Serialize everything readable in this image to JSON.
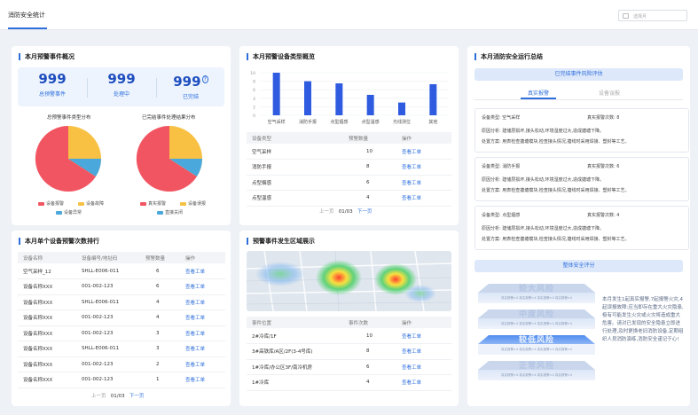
{
  "header": {
    "tab": "消防安全统计",
    "month_placeholder": "选择月"
  },
  "overview": {
    "title": "本月预警事件概况",
    "stats": [
      {
        "value": "999",
        "label": "总预警事件"
      },
      {
        "value": "999",
        "label": "处理中"
      },
      {
        "value": "999",
        "label": "已完结",
        "help": "?"
      }
    ],
    "pie1": {
      "title": "总预警事件类型分布"
    },
    "pie2": {
      "title": "已完结事件处理结果分布"
    },
    "legend1": [
      "设备报警",
      "设备故障",
      "设备异常"
    ],
    "legend2": [
      "真实报警",
      "设备误报",
      "直接关闭"
    ],
    "colors": {
      "red": "#f25562",
      "yellow": "#f8c144",
      "blue": "#4aa8dc"
    }
  },
  "chart_data": {
    "type": "bar",
    "title": "本月预警设备类型概览",
    "categories": [
      "空气采样",
      "消防手报",
      "点型烟感",
      "点型温感",
      "光线测位",
      "其他"
    ],
    "values": [
      10,
      8,
      7.5,
      4.8,
      3,
      7.3
    ],
    "ylim": [
      0,
      10
    ],
    "yticks": [
      "10",
      "8",
      "6",
      "4",
      "2",
      "0"
    ],
    "color": "#2e5be0"
  },
  "device_table": {
    "headers": [
      "设备类型",
      "预警数量",
      "操作"
    ],
    "rows": [
      [
        "空气采样",
        "10",
        "查看工单"
      ],
      [
        "消防手报",
        "8",
        "查看工单"
      ],
      [
        "点型烟感",
        "6",
        "查看工单"
      ],
      [
        "点型温感",
        "4",
        "查看工单"
      ]
    ],
    "pager": {
      "prev": "上一页",
      "page": "01/03",
      "next": "下一页"
    }
  },
  "ranking": {
    "title": "本月单个设备预警次数排行",
    "headers": [
      "设备名称",
      "设备编号/地址码",
      "预警数量",
      "操作"
    ],
    "rows": [
      [
        "空气采样_12",
        "SHLL-E006-011",
        "6",
        "查看工单"
      ],
      [
        "设备名称XXX",
        "001-002-123",
        "6",
        "查看工单"
      ],
      [
        "设备名称XXX",
        "SHLL-E006-011",
        "4",
        "查看工单"
      ],
      [
        "设备名称XXX",
        "001-002-123",
        "4",
        "查看工单"
      ],
      [
        "设备名称XXX",
        "001-002-123",
        "3",
        "查看工单"
      ],
      [
        "设备名称XXX",
        "SHLL-E006-011",
        "3",
        "查看工单"
      ],
      [
        "设备名称XXX",
        "001-002-123",
        "2",
        "查看工单"
      ],
      [
        "设备名称XXX",
        "001-002-123",
        "1",
        "查看工单"
      ]
    ],
    "pager": {
      "prev": "上一页",
      "page": "01/03",
      "next": "下一页"
    }
  },
  "area": {
    "title": "预警事件发生区域展示",
    "headers": [
      "事件位置",
      "事件次数",
      "操作"
    ],
    "rows": [
      [
        "2#冷库/1F",
        "10",
        "查看工单"
      ],
      [
        "3#高铁库/A区/2F(3-4号库)",
        "8",
        "查看工单"
      ],
      [
        "1#冷库/办公区3F/南冷机房",
        "6",
        "查看工单"
      ],
      [
        "1#冷库",
        "4",
        "查看工单"
      ]
    ]
  },
  "summary": {
    "title": "本月消防安全运行总结",
    "closed_eval": "已完结事件风险评估",
    "tabs": [
      "真实报警",
      "设备误报"
    ],
    "events": [
      {
        "type_label": "设备类型:",
        "type": "空气采样",
        "count_label": "真实报警次数:",
        "count": "8",
        "cause_label": "原因分析:",
        "cause": "建储层损坏,接头松动,环境湿度过大,造成搪塘下降。",
        "handle_label": "处置方案:",
        "handle": "用表检查搪塘模块,检查接头情况,搪线时采用焊接、塑封等工艺。"
      },
      {
        "type_label": "设备类型:",
        "type": "消防手报",
        "count_label": "真实报警次数:",
        "count": "6",
        "cause_label": "原因分析:",
        "cause": "建储层损坏,接头松动,环境湿度过大,造成搪塘下降。",
        "handle_label": "处置方案:",
        "handle": "用表检查搪塘模块,检查接头情况,搪线时采用焊接、塑封等工艺。"
      },
      {
        "type_label": "设备类型:",
        "type": "点型烟感",
        "count_label": "真实报警次数:",
        "count": "4",
        "cause_label": "原因分析:",
        "cause": "建储层损坏,接头松动,环境湿度过大,造成搪塘下降。",
        "handle_label": "处置方案:",
        "handle": "用表检查搪塘模块,检查接头情况,搪线时采用焊接、塑封等工艺。"
      }
    ],
    "overall": "整体安全评分",
    "pyramid": [
      {
        "label": "较大风险",
        "sub": "真实报警>4  真实报警>4  真实报警>4  真实报警>4"
      },
      {
        "label": "中度风险",
        "sub": "真实报警>4  真实报警>4  真实报警>4  真实报警>4"
      },
      {
        "label": "较低风险",
        "sub": "真实报警>4  真实报警>4  真实报警>4  真实报警>4"
      },
      {
        "label": "正常风险",
        "sub": "真实报警>4  真实报警>4  真实报警>4  真实报警>4"
      }
    ],
    "note": "本月发生1起真实报警,7起报警火灾,4起误报故障:应当即存在重大火灾隐患,极有可能发生火灾或火灾将造成重大危害。请对已发现的安全隐患立即进行处理,及时更换老旧消防设备,定期组织人员消防演练,消防安全谨记于心!"
  }
}
